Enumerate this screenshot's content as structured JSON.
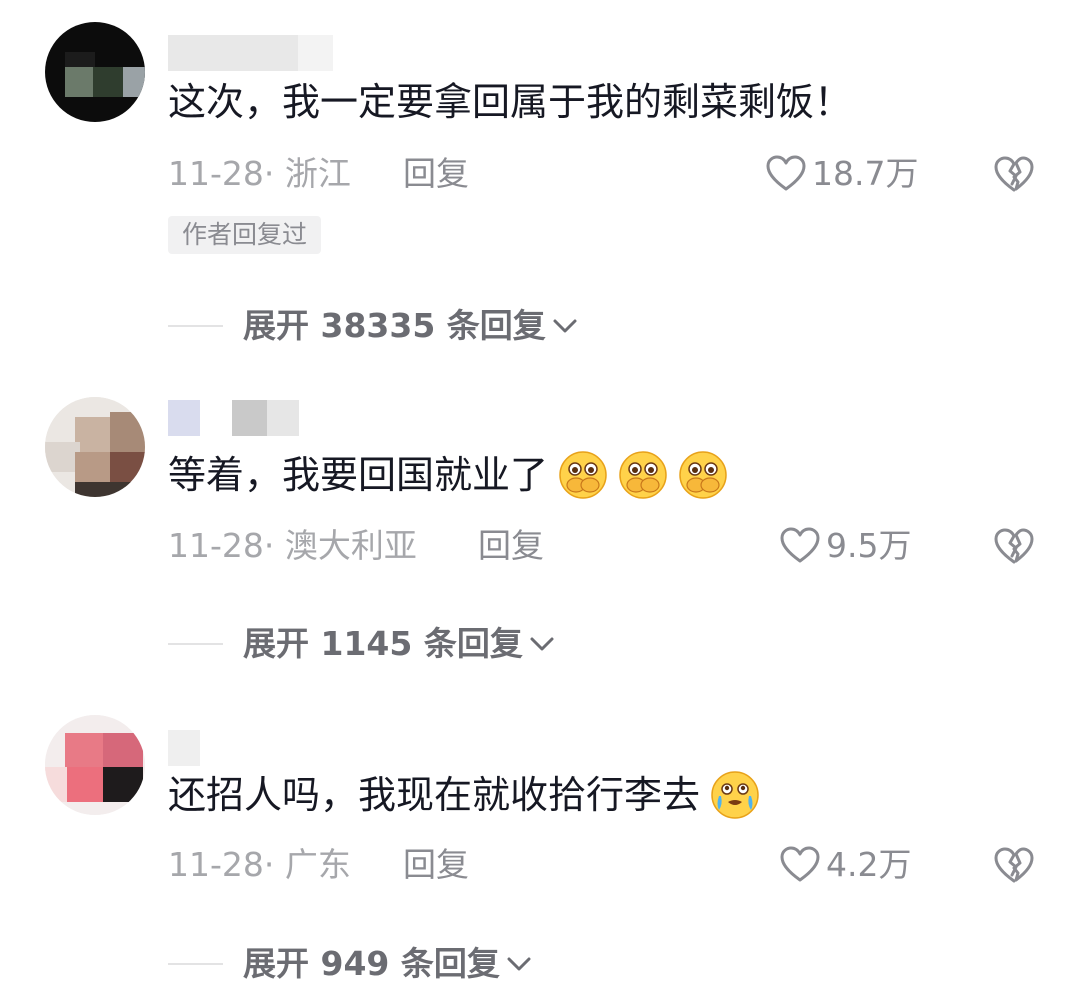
{
  "comments": [
    {
      "text": "这次，我一定要拿回属于我的剩菜剩饭！",
      "date": "11-28",
      "sep": "·",
      "location": "浙江",
      "reply_label": "回复",
      "likes": "18.7万",
      "author_badge": "作者回复过",
      "expand_label": "展开 38335 条回复",
      "emojis": []
    },
    {
      "text": "等着，我要回国就业了",
      "date": "11-28",
      "sep": "·",
      "location": "澳大利亚",
      "reply_label": "回复",
      "likes": "9.5万",
      "expand_label": "展开 1145 条回复",
      "emojis": [
        "covering-mouth-emoji",
        "covering-mouth-emoji",
        "covering-mouth-emoji"
      ]
    },
    {
      "text": "还招人吗，我现在就收拾行李去",
      "date": "11-28",
      "sep": "·",
      "location": "广东",
      "reply_label": "回复",
      "likes": "4.2万",
      "expand_label": "展开 949 条回复",
      "emojis": [
        "crying-emoji"
      ]
    }
  ],
  "icons": {
    "like": "heart-outline-icon",
    "dislike": "broken-heart-icon",
    "expand": "chevron-down-icon"
  },
  "colors": {
    "text": "#161823",
    "meta": "#a6a7ab",
    "action": "#8a8b91",
    "expand": "#6b6c72"
  }
}
